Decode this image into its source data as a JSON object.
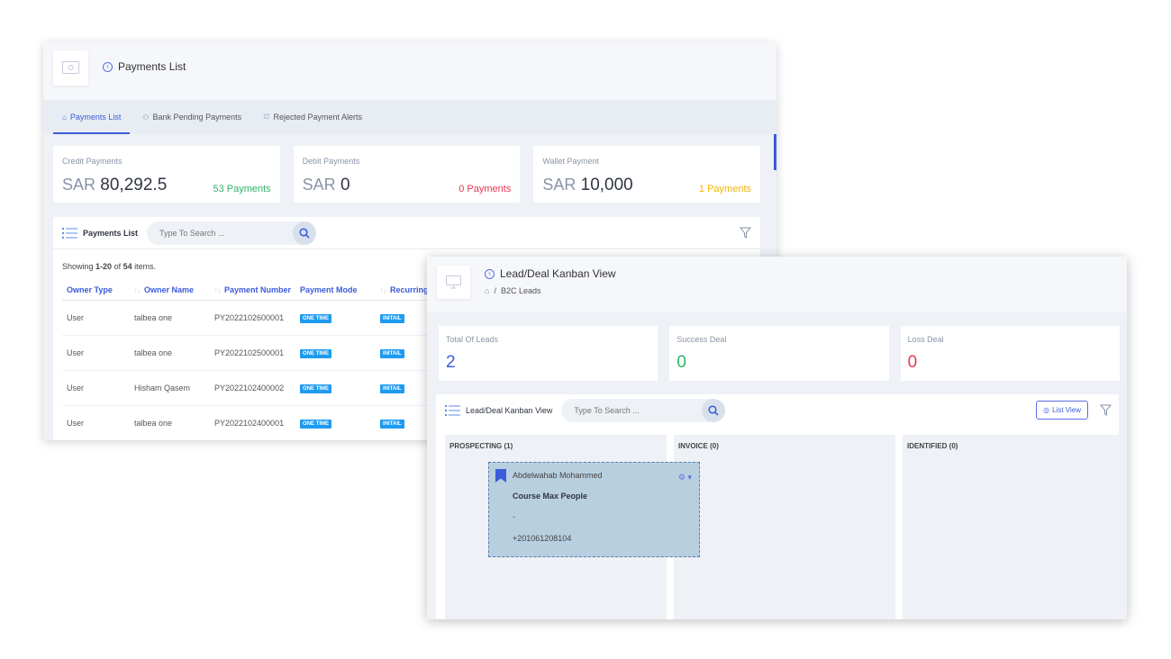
{
  "payments": {
    "title": "Payments List",
    "tabs": [
      {
        "label": "Payments List",
        "icon": "home-icon"
      },
      {
        "label": "Bank Pending Payments",
        "icon": "users-icon"
      },
      {
        "label": "Rejected Payment Alerts",
        "icon": "bank-icon"
      }
    ],
    "stats": [
      {
        "label": "Credit Payments",
        "currency": "SAR",
        "amount": "80,292.5",
        "count": "53 Payments",
        "color": "#2fb36b"
      },
      {
        "label": "Debit Payments",
        "currency": "SAR",
        "amount": "0",
        "count": "0 Payments",
        "color": "#e63757"
      },
      {
        "label": "Wallet Payment",
        "currency": "SAR",
        "amount": "10,000",
        "count": "1 Payments",
        "color": "#f5b400"
      }
    ],
    "list": {
      "title": "Payments List",
      "search_placeholder": "Type To Search ...",
      "showing_prefix": "Showing",
      "showing_range": "1-20",
      "showing_of": "of",
      "showing_total": "54",
      "showing_suffix": "items.",
      "columns": [
        "Owner Type",
        "Owner Name",
        "Payment Number",
        "Payment Mode",
        "Recurring"
      ],
      "rows": [
        {
          "owner_type": "User",
          "owner_name": "talbea one",
          "number": "PY2022102600001",
          "mode": "ONE TIME",
          "recurring": "INITAIL"
        },
        {
          "owner_type": "User",
          "owner_name": "talbea one",
          "number": "PY2022102500001",
          "mode": "ONE TIME",
          "recurring": "INITAIL"
        },
        {
          "owner_type": "User",
          "owner_name": "Hisham Qasem",
          "number": "PY2022102400002",
          "mode": "ONE TIME",
          "recurring": "INITAIL"
        },
        {
          "owner_type": "User",
          "owner_name": "talbea one",
          "number": "PY2022102400001",
          "mode": "ONE TIME",
          "recurring": "INITAIL"
        }
      ]
    }
  },
  "kanban": {
    "title": "Lead/Deal Kanban View",
    "breadcrumb": "B2C Leads",
    "breadcrumb_sep": "/",
    "stats": [
      {
        "label": "Total Of Leads",
        "value": "2",
        "color": "#3b5bdb"
      },
      {
        "label": "Success Deal",
        "value": "0",
        "color": "#2fb36b"
      },
      {
        "label": "Loss Deal",
        "value": "0",
        "color": "#e63757"
      }
    ],
    "board": {
      "title": "Lead/Deal Kanban View",
      "search_placeholder": "Type To Search ...",
      "list_view_label": "List View",
      "columns": [
        {
          "name": "PROSPECTING (1)"
        },
        {
          "name": "INVOICE (0)"
        },
        {
          "name": "IDENTIFIED (0)"
        }
      ],
      "card": {
        "name": "Abdelwahab Mohammed",
        "course": "Course Max People",
        "dash": "-",
        "phone": "+201061208104"
      }
    }
  },
  "accent": "#3b5bdb"
}
